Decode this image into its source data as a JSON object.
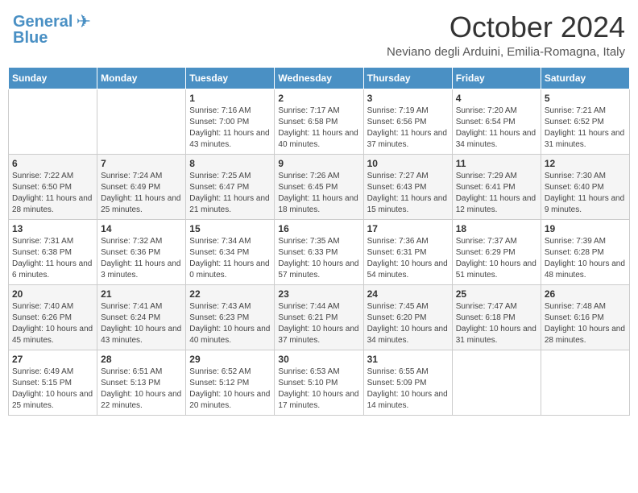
{
  "header": {
    "logo_line1": "General",
    "logo_line2": "Blue",
    "month": "October 2024",
    "location": "Neviano degli Arduini, Emilia-Romagna, Italy"
  },
  "weekdays": [
    "Sunday",
    "Monday",
    "Tuesday",
    "Wednesday",
    "Thursday",
    "Friday",
    "Saturday"
  ],
  "weeks": [
    [
      {
        "day": "",
        "sunrise": "",
        "sunset": "",
        "daylight": ""
      },
      {
        "day": "",
        "sunrise": "",
        "sunset": "",
        "daylight": ""
      },
      {
        "day": "1",
        "sunrise": "Sunrise: 7:16 AM",
        "sunset": "Sunset: 7:00 PM",
        "daylight": "Daylight: 11 hours and 43 minutes."
      },
      {
        "day": "2",
        "sunrise": "Sunrise: 7:17 AM",
        "sunset": "Sunset: 6:58 PM",
        "daylight": "Daylight: 11 hours and 40 minutes."
      },
      {
        "day": "3",
        "sunrise": "Sunrise: 7:19 AM",
        "sunset": "Sunset: 6:56 PM",
        "daylight": "Daylight: 11 hours and 37 minutes."
      },
      {
        "day": "4",
        "sunrise": "Sunrise: 7:20 AM",
        "sunset": "Sunset: 6:54 PM",
        "daylight": "Daylight: 11 hours and 34 minutes."
      },
      {
        "day": "5",
        "sunrise": "Sunrise: 7:21 AM",
        "sunset": "Sunset: 6:52 PM",
        "daylight": "Daylight: 11 hours and 31 minutes."
      }
    ],
    [
      {
        "day": "6",
        "sunrise": "Sunrise: 7:22 AM",
        "sunset": "Sunset: 6:50 PM",
        "daylight": "Daylight: 11 hours and 28 minutes."
      },
      {
        "day": "7",
        "sunrise": "Sunrise: 7:24 AM",
        "sunset": "Sunset: 6:49 PM",
        "daylight": "Daylight: 11 hours and 25 minutes."
      },
      {
        "day": "8",
        "sunrise": "Sunrise: 7:25 AM",
        "sunset": "Sunset: 6:47 PM",
        "daylight": "Daylight: 11 hours and 21 minutes."
      },
      {
        "day": "9",
        "sunrise": "Sunrise: 7:26 AM",
        "sunset": "Sunset: 6:45 PM",
        "daylight": "Daylight: 11 hours and 18 minutes."
      },
      {
        "day": "10",
        "sunrise": "Sunrise: 7:27 AM",
        "sunset": "Sunset: 6:43 PM",
        "daylight": "Daylight: 11 hours and 15 minutes."
      },
      {
        "day": "11",
        "sunrise": "Sunrise: 7:29 AM",
        "sunset": "Sunset: 6:41 PM",
        "daylight": "Daylight: 11 hours and 12 minutes."
      },
      {
        "day": "12",
        "sunrise": "Sunrise: 7:30 AM",
        "sunset": "Sunset: 6:40 PM",
        "daylight": "Daylight: 11 hours and 9 minutes."
      }
    ],
    [
      {
        "day": "13",
        "sunrise": "Sunrise: 7:31 AM",
        "sunset": "Sunset: 6:38 PM",
        "daylight": "Daylight: 11 hours and 6 minutes."
      },
      {
        "day": "14",
        "sunrise": "Sunrise: 7:32 AM",
        "sunset": "Sunset: 6:36 PM",
        "daylight": "Daylight: 11 hours and 3 minutes."
      },
      {
        "day": "15",
        "sunrise": "Sunrise: 7:34 AM",
        "sunset": "Sunset: 6:34 PM",
        "daylight": "Daylight: 11 hours and 0 minutes."
      },
      {
        "day": "16",
        "sunrise": "Sunrise: 7:35 AM",
        "sunset": "Sunset: 6:33 PM",
        "daylight": "Daylight: 10 hours and 57 minutes."
      },
      {
        "day": "17",
        "sunrise": "Sunrise: 7:36 AM",
        "sunset": "Sunset: 6:31 PM",
        "daylight": "Daylight: 10 hours and 54 minutes."
      },
      {
        "day": "18",
        "sunrise": "Sunrise: 7:37 AM",
        "sunset": "Sunset: 6:29 PM",
        "daylight": "Daylight: 10 hours and 51 minutes."
      },
      {
        "day": "19",
        "sunrise": "Sunrise: 7:39 AM",
        "sunset": "Sunset: 6:28 PM",
        "daylight": "Daylight: 10 hours and 48 minutes."
      }
    ],
    [
      {
        "day": "20",
        "sunrise": "Sunrise: 7:40 AM",
        "sunset": "Sunset: 6:26 PM",
        "daylight": "Daylight: 10 hours and 45 minutes."
      },
      {
        "day": "21",
        "sunrise": "Sunrise: 7:41 AM",
        "sunset": "Sunset: 6:24 PM",
        "daylight": "Daylight: 10 hours and 43 minutes."
      },
      {
        "day": "22",
        "sunrise": "Sunrise: 7:43 AM",
        "sunset": "Sunset: 6:23 PM",
        "daylight": "Daylight: 10 hours and 40 minutes."
      },
      {
        "day": "23",
        "sunrise": "Sunrise: 7:44 AM",
        "sunset": "Sunset: 6:21 PM",
        "daylight": "Daylight: 10 hours and 37 minutes."
      },
      {
        "day": "24",
        "sunrise": "Sunrise: 7:45 AM",
        "sunset": "Sunset: 6:20 PM",
        "daylight": "Daylight: 10 hours and 34 minutes."
      },
      {
        "day": "25",
        "sunrise": "Sunrise: 7:47 AM",
        "sunset": "Sunset: 6:18 PM",
        "daylight": "Daylight: 10 hours and 31 minutes."
      },
      {
        "day": "26",
        "sunrise": "Sunrise: 7:48 AM",
        "sunset": "Sunset: 6:16 PM",
        "daylight": "Daylight: 10 hours and 28 minutes."
      }
    ],
    [
      {
        "day": "27",
        "sunrise": "Sunrise: 6:49 AM",
        "sunset": "Sunset: 5:15 PM",
        "daylight": "Daylight: 10 hours and 25 minutes."
      },
      {
        "day": "28",
        "sunrise": "Sunrise: 6:51 AM",
        "sunset": "Sunset: 5:13 PM",
        "daylight": "Daylight: 10 hours and 22 minutes."
      },
      {
        "day": "29",
        "sunrise": "Sunrise: 6:52 AM",
        "sunset": "Sunset: 5:12 PM",
        "daylight": "Daylight: 10 hours and 20 minutes."
      },
      {
        "day": "30",
        "sunrise": "Sunrise: 6:53 AM",
        "sunset": "Sunset: 5:10 PM",
        "daylight": "Daylight: 10 hours and 17 minutes."
      },
      {
        "day": "31",
        "sunrise": "Sunrise: 6:55 AM",
        "sunset": "Sunset: 5:09 PM",
        "daylight": "Daylight: 10 hours and 14 minutes."
      },
      {
        "day": "",
        "sunrise": "",
        "sunset": "",
        "daylight": ""
      },
      {
        "day": "",
        "sunrise": "",
        "sunset": "",
        "daylight": ""
      }
    ]
  ]
}
